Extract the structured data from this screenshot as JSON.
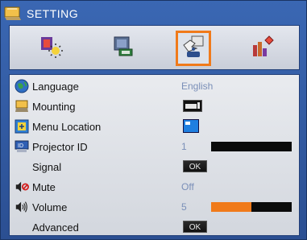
{
  "window": {
    "title": "SETTING",
    "title_icon": "settings-monitor-icon"
  },
  "tabs": [
    {
      "name": "image-tab",
      "icon": "image-brightness-icon",
      "active": false
    },
    {
      "name": "display-tab",
      "icon": "display-screen-icon",
      "active": false
    },
    {
      "name": "setting-tab",
      "icon": "setting-hand-icon",
      "active": true
    },
    {
      "name": "options-tab",
      "icon": "options-bars-icon",
      "active": false
    }
  ],
  "items": {
    "language": {
      "label": "Language",
      "value": "English",
      "icon": "globe-icon"
    },
    "mounting": {
      "label": "Mounting",
      "icon": "projector-mounting-icon",
      "value_icon": "front-desktop-icon"
    },
    "menu_location": {
      "label": "Menu Location",
      "icon": "menu-location-icon",
      "value_icon": "top-left-position-icon"
    },
    "projector_id": {
      "label": "Projector ID",
      "value": "1",
      "icon": "projector-id-icon",
      "level": 0.0
    },
    "signal": {
      "label": "Signal",
      "button": "OK"
    },
    "mute": {
      "label": "Mute",
      "value": "Off",
      "icon": "mute-icon"
    },
    "volume": {
      "label": "Volume",
      "value": "5",
      "icon": "volume-icon",
      "level": 0.5
    },
    "advanced": {
      "label": "Advanced",
      "button": "OK"
    }
  },
  "colors": {
    "accent": "#f07a1a",
    "frame": "#2b4f92",
    "value_text": "#7a8fb8"
  }
}
